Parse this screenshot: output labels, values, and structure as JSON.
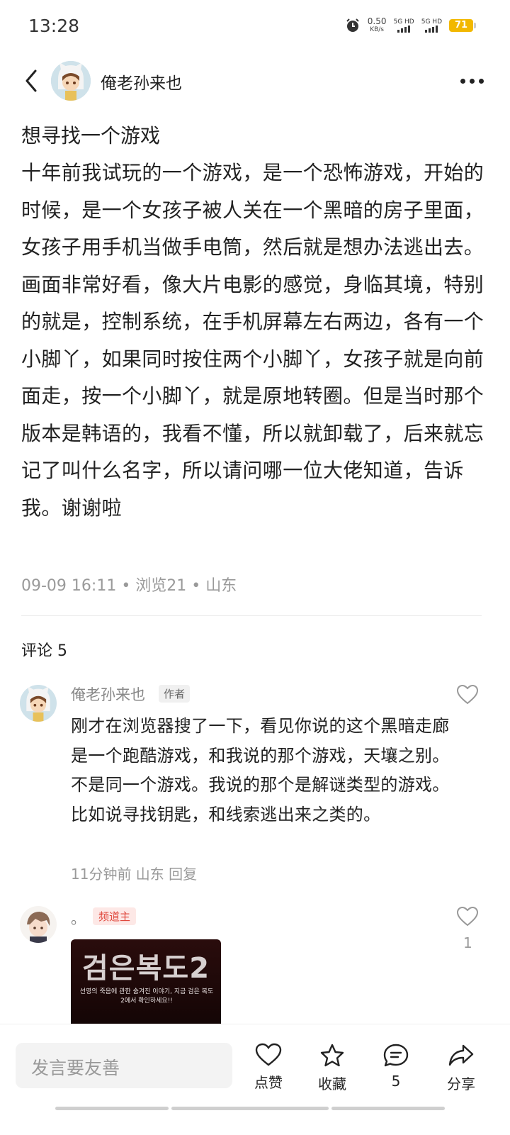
{
  "status": {
    "time": "13:28",
    "speed_value": "0.50",
    "speed_unit": "KB/s",
    "sig1": "5G HD",
    "sig2": "5G HD",
    "battery": "71",
    "battery_color": "#f2b800"
  },
  "header": {
    "author": "俺老孙来也"
  },
  "post": {
    "title": "想寻找一个游戏",
    "body": "十年前我试玩的一个游戏，是一个恐怖游戏，开始的时候，是一个女孩子被人关在一个黑暗的房子里面，女孩子用手机当做手电筒，然后就是想办法逃出去。画面非常好看，像大片电影的感觉，身临其境，特别的就是，控制系统，在手机屏幕左右两边，各有一个小脚丫，如果同时按住两个小脚丫，女孩子就是向前面走，按一个小脚丫，就是原地转圈。但是当时那个版本是韩语的，我看不懂，所以就卸载了，后来就忘记了叫什么名字，所以请问哪一位大佬知道，告诉我。谢谢啦",
    "meta": "09-09 16:11 • 浏览21 • 山东"
  },
  "comments": {
    "title": "评论 5",
    "items": [
      {
        "name": "俺老孙来也",
        "tag": "作者",
        "text": "刚才在浏览器搜了一下，看见你说的这个黑暗走廊是一个跑酷游戏，和我说的那个游戏，天壤之别。不是同一个游戏。我说的那个是解谜类型的游戏。比如说寻找钥匙，和线索逃出来之类的。",
        "meta": "11分钟前 山东 回复"
      },
      {
        "name": "。",
        "tag": "频道主",
        "likes": "1",
        "image_title": "검은복도2",
        "image_sub": "선영의 죽음에 관한 숨겨진 이야기, 지금 검은 복도2에서 확인하세요!!"
      }
    ]
  },
  "bottom": {
    "input_placeholder": "发言要友善",
    "like_label": "点赞",
    "fav_label": "收藏",
    "comment_count": "5",
    "share_label": "分享"
  }
}
